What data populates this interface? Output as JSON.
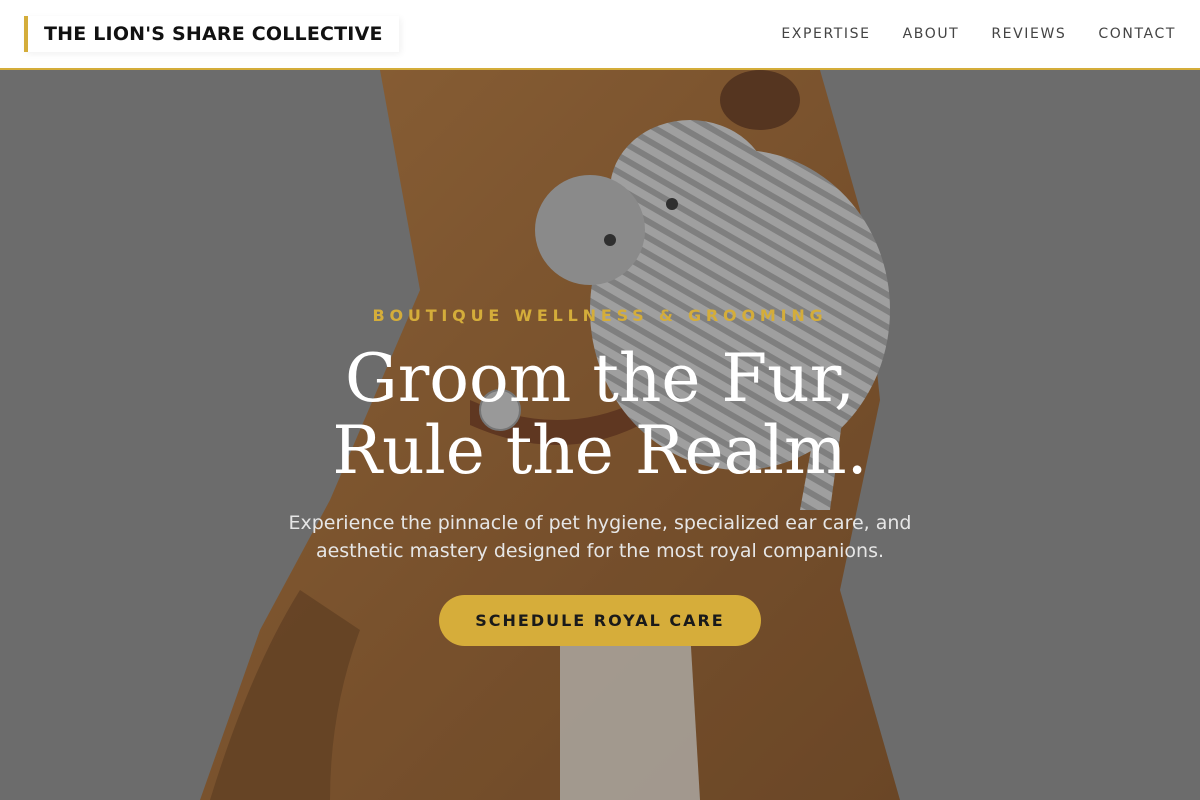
{
  "header": {
    "brand": "THE LION'S SHARE COLLECTIVE",
    "nav": [
      {
        "label": "EXPERTISE"
      },
      {
        "label": "ABOUT"
      },
      {
        "label": "REVIEWS"
      },
      {
        "label": "CONTACT"
      }
    ]
  },
  "hero": {
    "eyebrow": "BOUTIQUE WELLNESS & GROOMING",
    "headline_line1": "Groom the Fur,",
    "headline_line2": "Rule the Realm.",
    "subtext": "Experience the pinnacle of pet hygiene, specialized ear care, and aesthetic mastery designed for the most royal companions.",
    "cta_label": "SCHEDULE ROYAL CARE",
    "image_subject": "golden dog holding a striped knitted elephant toy"
  },
  "colors": {
    "accent": "#d4ad3a",
    "header_bg": "#ffffff",
    "hero_text": "#ffffff"
  }
}
